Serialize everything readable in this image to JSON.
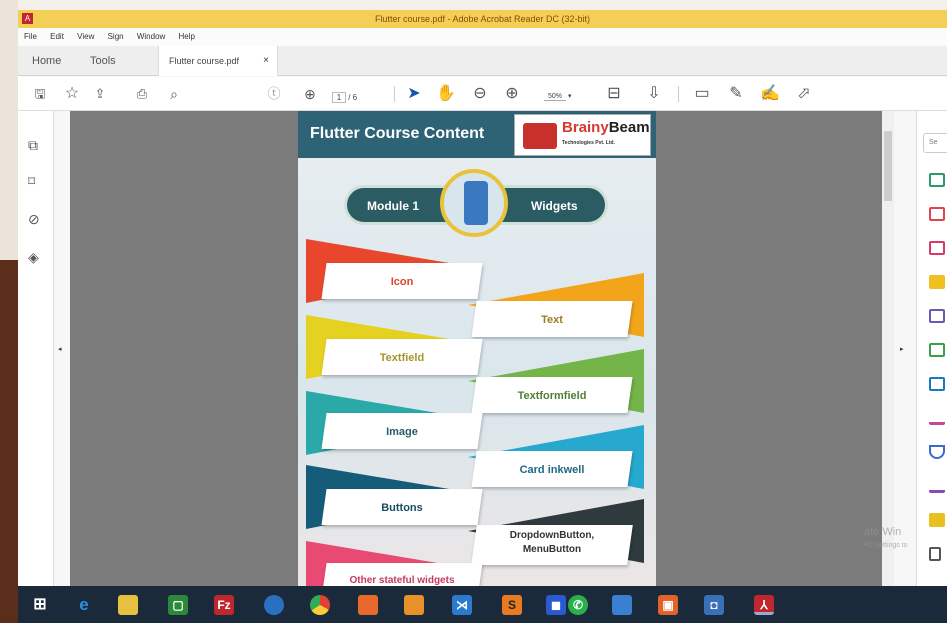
{
  "window": {
    "title": "Flutter course.pdf - Adobe Acrobat Reader DC (32-bit)"
  },
  "menu": [
    "File",
    "Edit",
    "View",
    "Sign",
    "Window",
    "Help"
  ],
  "tabs": {
    "home": "Home",
    "tools": "Tools",
    "document": "Flutter course.pdf",
    "close": "×"
  },
  "toolbar": {
    "page_current": "1",
    "page_total": "/ 6",
    "zoom": "50%",
    "icons": [
      "save-icon",
      "star-icon",
      "upload-icon",
      "print-icon",
      "search-icon",
      "page-up-icon",
      "page-down-icon",
      "select-cursor-icon",
      "hand-icon",
      "zoom-out-icon",
      "zoom-in-icon",
      "zoom-dropdown-icon",
      "fit-page-icon",
      "scroll-mode-icon",
      "comment-icon",
      "highlight-pen-icon",
      "sign-icon",
      "share-icon"
    ]
  },
  "left_pane": {
    "icons": [
      "pages-icon",
      "bookmark-icon",
      "attachment-icon",
      "layers-icon"
    ]
  },
  "right_pane": {
    "search_placeholder": "Se",
    "tool_icons": [
      "export-pdf-icon",
      "create-pdf-icon",
      "edit-pdf-icon",
      "comment-tool-icon",
      "combine-files-icon",
      "organize-pages-icon",
      "scan-ocr-icon",
      "fill-sign-icon",
      "protect-icon",
      "more-tools-icon",
      "stamp-icon",
      "wrench-icon"
    ]
  },
  "pdf": {
    "title": "Flutter Course Content",
    "logo": {
      "brand_a": "Brainy",
      "brand_b": "Beam",
      "subtitle": "Technologies Pvt. Ltd."
    },
    "module": {
      "left": "Module 1",
      "right": "Widgets"
    },
    "topics": [
      "Icon",
      "Text",
      "Textfield",
      "Textformfield",
      "Image",
      "Card inkwell",
      "Buttons",
      "DropdownButton, MenuButton",
      "Other stateful widgets"
    ],
    "topic_colors": {
      "red": "#e8472e",
      "orange": "#f2a51a",
      "yellow": "#e5d11f",
      "green": "#73b548",
      "teal": "#2aa9a8",
      "blue": "#27a8cf",
      "navy": "#145c78",
      "dark": "#2e3a3e",
      "pink": "#e84a73"
    }
  },
  "watermark": {
    "line1": "ate Win",
    "line2": "PC settings to"
  },
  "taskbar": {
    "icons": [
      "windows-start-icon",
      "edge-icon",
      "file-explorer-icon",
      "store-icon",
      "filezilla-icon",
      "chrome-blue-icon",
      "chrome-icon",
      "app-orange-icon",
      "app-orange2-icon",
      "vscode-icon",
      "sublime-icon",
      "app-blue-icon",
      "whatsapp-icon",
      "photos-icon",
      "powerpoint-icon",
      "outlook-icon",
      "acrobat-icon"
    ]
  }
}
